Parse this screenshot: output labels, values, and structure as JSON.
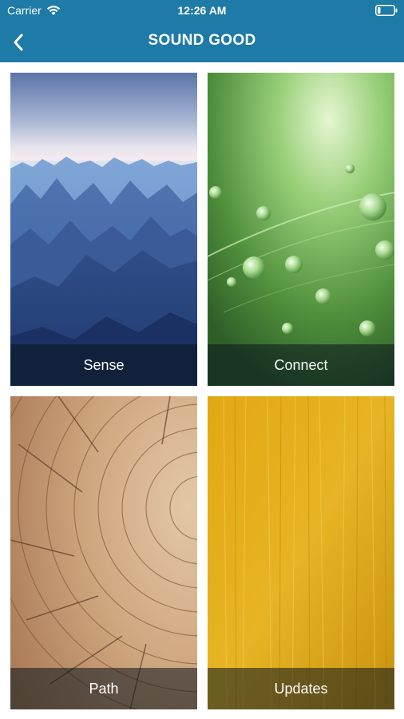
{
  "status_bar": {
    "carrier": "Carrier",
    "time": "12:26 AM",
    "wifi_icon": "wifi-icon",
    "battery_icon": "battery-low-icon"
  },
  "nav": {
    "title": "SOUND GOOD",
    "back_icon": "chevron-left-icon"
  },
  "colors": {
    "header_bg": "#1e7aa6",
    "text": "#ffffff"
  },
  "tiles": [
    {
      "label": "Sense",
      "theme": "blue mountains"
    },
    {
      "label": "Connect",
      "theme": "green leaf with water drops"
    },
    {
      "label": "Path",
      "theme": "wood tree rings"
    },
    {
      "label": "Updates",
      "theme": "yellow textured wall"
    }
  ]
}
